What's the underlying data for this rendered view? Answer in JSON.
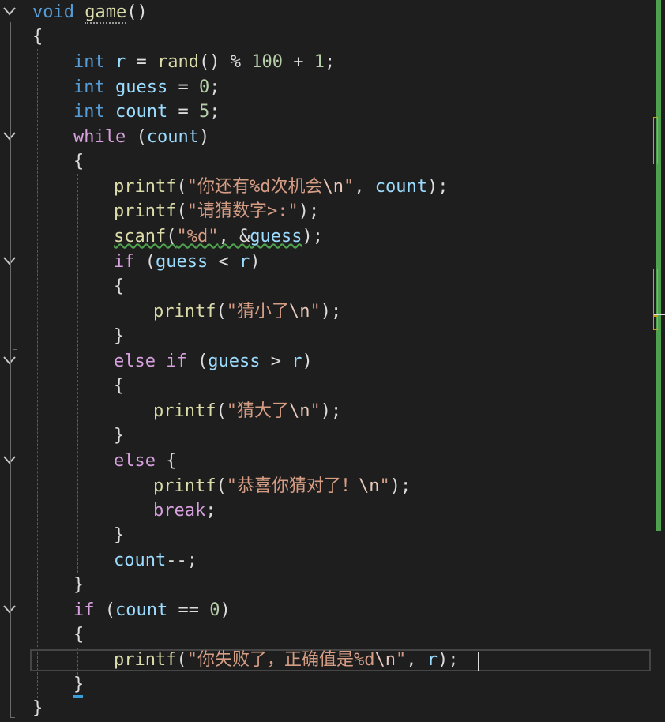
{
  "editor": {
    "language": "C",
    "lines": [
      {
        "id": "l1",
        "segs": [
          [
            "kw",
            "void"
          ],
          [
            "pl",
            " "
          ],
          [
            "fn",
            "game"
          ],
          [
            "pl",
            "()"
          ]
        ]
      },
      {
        "id": "l2",
        "segs": [
          [
            "pl",
            "{"
          ]
        ]
      },
      {
        "id": "l3",
        "segs": [
          [
            "kw",
            "int"
          ],
          [
            "pl",
            " "
          ],
          [
            "var",
            "r"
          ],
          [
            "pl",
            " = "
          ],
          [
            "fn",
            "rand"
          ],
          [
            "pl",
            "() % "
          ],
          [
            "num",
            "100"
          ],
          [
            "pl",
            " + "
          ],
          [
            "num",
            "1"
          ],
          [
            "pl",
            ";"
          ]
        ]
      },
      {
        "id": "l4",
        "segs": [
          [
            "kw",
            "int"
          ],
          [
            "pl",
            " "
          ],
          [
            "var",
            "guess"
          ],
          [
            "pl",
            " = "
          ],
          [
            "num",
            "0"
          ],
          [
            "pl",
            ";"
          ]
        ]
      },
      {
        "id": "l5",
        "segs": [
          [
            "kw",
            "int"
          ],
          [
            "pl",
            " "
          ],
          [
            "var",
            "count"
          ],
          [
            "pl",
            " = "
          ],
          [
            "num",
            "5"
          ],
          [
            "pl",
            ";"
          ]
        ]
      },
      {
        "id": "l6",
        "segs": [
          [
            "ctl",
            "while"
          ],
          [
            "pl",
            " ("
          ],
          [
            "var",
            "count"
          ],
          [
            "pl",
            ")"
          ]
        ]
      },
      {
        "id": "l7",
        "segs": [
          [
            "pl",
            "{"
          ]
        ]
      },
      {
        "id": "l8",
        "segs": [
          [
            "fn",
            "printf"
          ],
          [
            "pl",
            "("
          ],
          [
            "str",
            "\"你还有%d次机会"
          ],
          [
            "esc",
            "\\n"
          ],
          [
            "str",
            "\""
          ],
          [
            "pl",
            ", "
          ],
          [
            "var",
            "count"
          ],
          [
            "pl",
            ");"
          ]
        ]
      },
      {
        "id": "l9",
        "segs": [
          [
            "fn",
            "printf"
          ],
          [
            "pl",
            "("
          ],
          [
            "str",
            "\"请猜数字>:\""
          ],
          [
            "pl",
            ");"
          ]
        ]
      },
      {
        "id": "l10",
        "segs": [
          [
            "fn",
            "scanf"
          ],
          [
            "pl",
            "("
          ],
          [
            "str",
            "\"%d\""
          ],
          [
            "pl",
            ", &"
          ],
          [
            "var",
            "guess"
          ],
          [
            "pl",
            ");"
          ]
        ]
      },
      {
        "id": "l11",
        "segs": [
          [
            "ctl",
            "if"
          ],
          [
            "pl",
            " ("
          ],
          [
            "var",
            "guess"
          ],
          [
            "pl",
            " < "
          ],
          [
            "var",
            "r"
          ],
          [
            "pl",
            ")"
          ]
        ]
      },
      {
        "id": "l12",
        "segs": [
          [
            "pl",
            "{"
          ]
        ]
      },
      {
        "id": "l13",
        "segs": [
          [
            "fn",
            "printf"
          ],
          [
            "pl",
            "("
          ],
          [
            "str",
            "\"猜小了"
          ],
          [
            "esc",
            "\\n"
          ],
          [
            "str",
            "\""
          ],
          [
            "pl",
            ");"
          ]
        ]
      },
      {
        "id": "l14",
        "segs": [
          [
            "pl",
            "}"
          ]
        ]
      },
      {
        "id": "l15",
        "segs": [
          [
            "ctl",
            "else"
          ],
          [
            "pl",
            " "
          ],
          [
            "ctl",
            "if"
          ],
          [
            "pl",
            " ("
          ],
          [
            "var",
            "guess"
          ],
          [
            "pl",
            " > "
          ],
          [
            "var",
            "r"
          ],
          [
            "pl",
            ")"
          ]
        ]
      },
      {
        "id": "l16",
        "segs": [
          [
            "pl",
            "{"
          ]
        ]
      },
      {
        "id": "l17",
        "segs": [
          [
            "fn",
            "printf"
          ],
          [
            "pl",
            "("
          ],
          [
            "str",
            "\"猜大了"
          ],
          [
            "esc",
            "\\n"
          ],
          [
            "str",
            "\""
          ],
          [
            "pl",
            ");"
          ]
        ]
      },
      {
        "id": "l18",
        "segs": [
          [
            "pl",
            "}"
          ]
        ]
      },
      {
        "id": "l19",
        "segs": [
          [
            "ctl",
            "else"
          ],
          [
            "pl",
            " {"
          ]
        ]
      },
      {
        "id": "l20",
        "segs": [
          [
            "fn",
            "printf"
          ],
          [
            "pl",
            "("
          ],
          [
            "str",
            "\"恭喜你猜对了！"
          ],
          [
            "esc",
            "\\n"
          ],
          [
            "str",
            "\""
          ],
          [
            "pl",
            ");"
          ]
        ]
      },
      {
        "id": "l21",
        "segs": [
          [
            "ctl",
            "break"
          ],
          [
            "pl",
            ";"
          ]
        ]
      },
      {
        "id": "l22",
        "segs": [
          [
            "pl",
            "}"
          ]
        ]
      },
      {
        "id": "l23",
        "segs": [
          [
            "var",
            "count"
          ],
          [
            "pl",
            "--;"
          ]
        ]
      },
      {
        "id": "l24",
        "segs": [
          [
            "pl",
            "}"
          ]
        ]
      },
      {
        "id": "l25",
        "segs": [
          [
            "ctl",
            "if"
          ],
          [
            "pl",
            " ("
          ],
          [
            "var",
            "count"
          ],
          [
            "pl",
            " == "
          ],
          [
            "num",
            "0"
          ],
          [
            "pl",
            ")"
          ]
        ]
      },
      {
        "id": "l26",
        "segs": [
          [
            "pl",
            "{"
          ]
        ]
      },
      {
        "id": "l27",
        "segs": [
          [
            "fn",
            "printf"
          ],
          [
            "pl",
            "("
          ],
          [
            "str",
            "\"你失败了，正确值是%d"
          ],
          [
            "esc",
            "\\n"
          ],
          [
            "str",
            "\""
          ],
          [
            "pl",
            ", "
          ],
          [
            "var",
            "r"
          ],
          [
            "pl",
            ");"
          ]
        ]
      },
      {
        "id": "l28",
        "segs": [
          [
            "pl",
            "}"
          ]
        ]
      },
      {
        "id": "l29",
        "segs": [
          [
            "pl",
            "}"
          ]
        ]
      }
    ]
  },
  "icons": {
    "fold": "chevron-down-icon"
  },
  "colors": {
    "background": "#1e1e1e",
    "keyword": "#569cd6",
    "control": "#d8a0df",
    "function": "#dcdcaa",
    "variable": "#9cdcfe",
    "number": "#b5cea8",
    "string": "#d69d85",
    "change_bar": "#4ea24e"
  }
}
